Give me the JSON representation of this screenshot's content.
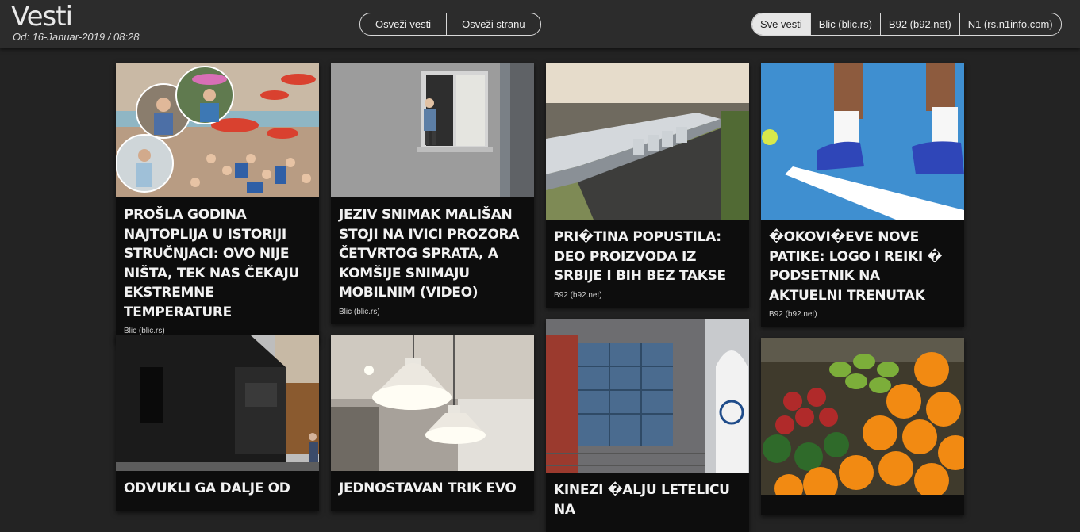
{
  "header": {
    "title": "Vesti",
    "date": "Od: 16-Januar-2019 / 08:28",
    "refresh_news": "Osveži vesti",
    "refresh_page": "Osveži stranu",
    "sources": [
      "Sve vesti",
      "Blic (blic.rs)",
      "B92 (b92.net)",
      "N1 (rs.n1info.com)"
    ],
    "active_source": "Sve vesti"
  },
  "cards": [
    {
      "headline": "Prošla godina najtoplija u istoriji stručnjaci: Ovo nije ništa, tek nas čekaju ekstremne temperature",
      "source": "Blic (blic.rs)",
      "image": "beach-crowd-photo"
    },
    {
      "headline": "Jeziv snimak mališan stoji na ivici prozora četvrtog sprata, a komšije snimaju mobilnim (VIDEO)",
      "source": "Blic (blic.rs)",
      "image": "window-child-photo"
    },
    {
      "headline": "Pri�tina popustila: Deo proizvoda iz Srbije i BiH bez takse",
      "source": "B92 (b92.net)",
      "image": "warehouse-aerial-photo"
    },
    {
      "headline": "�okovi�eve nove patike: Logo i reiki � podsetnik na aktuelni trenutak",
      "source": "B92 (b92.net)",
      "image": "tennis-shoes-photo"
    },
    {
      "headline": "Odvukli ga dalje od",
      "source": "",
      "image": "black-building-photo"
    },
    {
      "headline": "Jednostavan trik evo",
      "source": "",
      "image": "pendant-lamps-photo"
    },
    {
      "headline": "Kinezi �alju letelicu na",
      "source": "",
      "image": "rocket-launch-photo"
    },
    {
      "headline": "",
      "source": "",
      "image": "fruit-market-photo"
    }
  ]
}
